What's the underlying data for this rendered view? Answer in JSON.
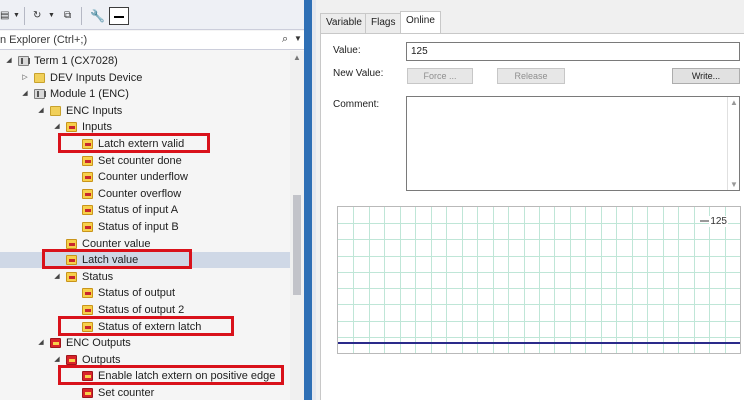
{
  "search": {
    "placeholder": "n Explorer (Ctrl+;)",
    "icon": "search-icon"
  },
  "toolbar": {
    "icons": [
      "device-icon",
      "dropdown-arrow",
      "refresh-icon",
      "collapse-icon",
      "wrench-icon",
      "minimize-icon"
    ]
  },
  "tree": [
    {
      "label": "Term 1 (CX7028)",
      "icon": "term",
      "expander": "◢",
      "indent": 0,
      "selected": false
    },
    {
      "label": "DEV Inputs Device",
      "icon": "folder",
      "expander": "▷",
      "indent": 1,
      "selected": false
    },
    {
      "label": "Module 1 (ENC)",
      "icon": "term",
      "expander": "◢",
      "indent": 1,
      "selected": false
    },
    {
      "label": "ENC Inputs",
      "icon": "folder",
      "expander": "◢",
      "indent": 2,
      "selected": false
    },
    {
      "label": "Inputs",
      "icon": "in",
      "expander": "◢",
      "indent": 3,
      "selected": false
    },
    {
      "label": "Latch extern valid",
      "icon": "in",
      "expander": "",
      "indent": 4,
      "selected": false
    },
    {
      "label": "Set counter done",
      "icon": "in",
      "expander": "",
      "indent": 4,
      "selected": false
    },
    {
      "label": "Counter underflow",
      "icon": "in",
      "expander": "",
      "indent": 4,
      "selected": false
    },
    {
      "label": "Counter overflow",
      "icon": "in",
      "expander": "",
      "indent": 4,
      "selected": false
    },
    {
      "label": "Status of input A",
      "icon": "in",
      "expander": "",
      "indent": 4,
      "selected": false
    },
    {
      "label": "Status of input B",
      "icon": "in",
      "expander": "",
      "indent": 4,
      "selected": false
    },
    {
      "label": "Counter value",
      "icon": "in",
      "expander": "",
      "indent": 3,
      "selected": false
    },
    {
      "label": "Latch value",
      "icon": "in",
      "expander": "",
      "indent": 3,
      "selected": true
    },
    {
      "label": "Status",
      "icon": "in",
      "expander": "◢",
      "indent": 3,
      "selected": false
    },
    {
      "label": "Status of output",
      "icon": "in",
      "expander": "",
      "indent": 4,
      "selected": false
    },
    {
      "label": "Status of output 2",
      "icon": "in",
      "expander": "",
      "indent": 4,
      "selected": false
    },
    {
      "label": "Status of extern latch",
      "icon": "in",
      "expander": "",
      "indent": 4,
      "selected": false
    },
    {
      "label": "ENC Outputs",
      "icon": "out",
      "expander": "◢",
      "indent": 2,
      "selected": false
    },
    {
      "label": "Outputs",
      "icon": "out",
      "expander": "◢",
      "indent": 3,
      "selected": false
    },
    {
      "label": "Enable latch extern on positive edge",
      "icon": "out",
      "expander": "",
      "indent": 4,
      "selected": false
    },
    {
      "label": "Set counter",
      "icon": "out",
      "expander": "",
      "indent": 4,
      "selected": false
    }
  ],
  "highlighted_items": [
    "Latch extern valid",
    "Latch value",
    "Status of extern latch",
    "Enable latch extern on positive edge"
  ],
  "highlight_color": "#d9121b",
  "tabs": [
    {
      "label": "Variable",
      "active": false
    },
    {
      "label": "Flags",
      "active": false
    },
    {
      "label": "Online",
      "active": true
    }
  ],
  "online": {
    "value_label": "Value:",
    "value": "125",
    "new_value_label": "New Value:",
    "force_label": "Force ...",
    "release_label": "Release",
    "write_label": "Write...",
    "comment_label": "Comment:",
    "graph_value": "125"
  },
  "colors": {
    "splitter": "#2e6fb5",
    "grid": "#bfe6d7",
    "graph_line": "#2a2a8a"
  }
}
